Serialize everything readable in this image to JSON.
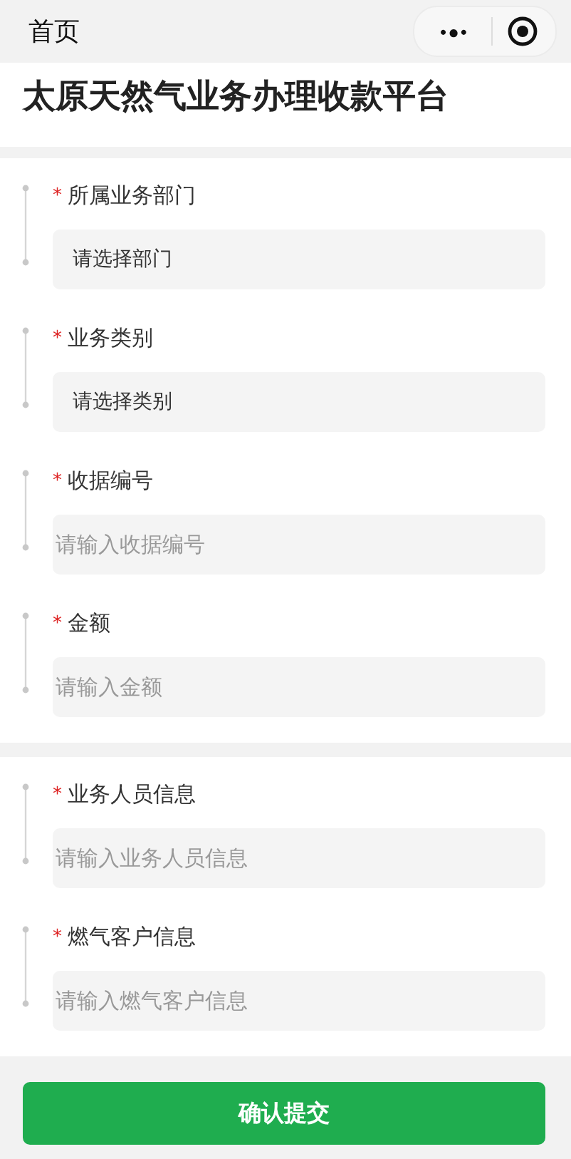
{
  "nav_bar": {
    "title": "首页",
    "more_icon": "•●•"
  },
  "page_title": "太原天然气业务办理收款平台",
  "sections": [
    {
      "fields": [
        {
          "label": "所属业务部门",
          "required_mark": "*",
          "kind": "select",
          "placeholder": "请选择部门"
        },
        {
          "label": "业务类别",
          "required_mark": "*",
          "kind": "select",
          "placeholder": "请选择类别"
        },
        {
          "label": "收据编号",
          "required_mark": "*",
          "kind": "input",
          "placeholder": "请输入收据编号"
        },
        {
          "label": "金额",
          "required_mark": "*",
          "kind": "input",
          "placeholder": "请输入金额"
        }
      ]
    },
    {
      "fields": [
        {
          "label": "业务人员信息",
          "required_mark": "*",
          "kind": "input",
          "placeholder": "请输入业务人员信息"
        },
        {
          "label": "燃气客户信息",
          "required_mark": "*",
          "kind": "input",
          "placeholder": "请输入燃气客户信息"
        }
      ]
    }
  ],
  "submit_button": "确认提交"
}
